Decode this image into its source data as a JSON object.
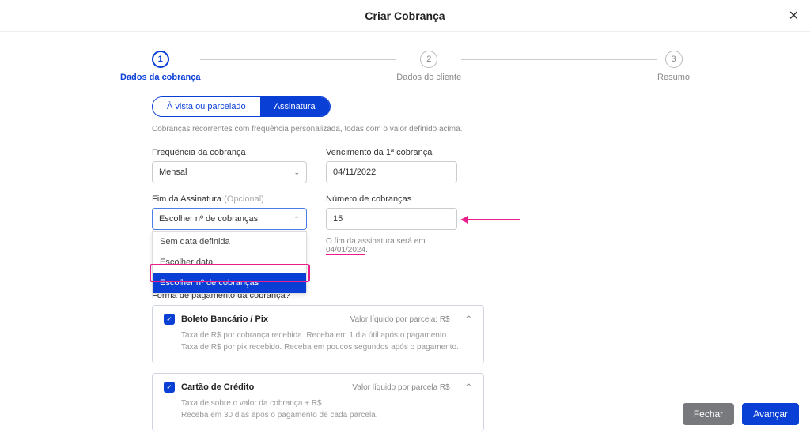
{
  "header": {
    "title": "Criar Cobrança"
  },
  "stepper": {
    "steps": [
      {
        "num": "1",
        "label": "Dados da cobrança"
      },
      {
        "num": "2",
        "label": "Dados do cliente"
      },
      {
        "num": "3",
        "label": "Resumo"
      }
    ]
  },
  "tabs": {
    "avista": "À vista ou parcelado",
    "assinatura": "Assinatura"
  },
  "helper": "Cobranças recorrentes com frequência personalizada, todas com o valor definido acima.",
  "freq": {
    "label": "Frequência da cobrança",
    "value": "Mensal"
  },
  "venc": {
    "label": "Vencimento da 1ª cobrança",
    "value": "04/11/2022"
  },
  "fim": {
    "label": "Fim da Assinatura ",
    "opt": "(Opcional)",
    "value": "Escolher nº de cobranças",
    "options": [
      "Sem data definida",
      "Escolher data",
      "Escolher nº de cobranças"
    ]
  },
  "num": {
    "label": "Número de cobranças",
    "value": "15",
    "hint_prefix": "O fim da assinatura será em ",
    "hint_date": "04/01/2024",
    "hint_suffix": "."
  },
  "forma": {
    "label": "Forma de pagamento da cobrança?"
  },
  "pm1": {
    "title": "Boleto Bancário / Pix",
    "right": "Valor líquido por parcela: R$",
    "line1": "Taxa de R$        por cobrança recebida. Receba em 1 dia útil após o pagamento.",
    "line2": "Taxa de R$        por pix recebido. Receba em poucos segundos após o pagamento."
  },
  "pm2": {
    "title": "Cartão de Crédito",
    "right": "Valor líquido por parcela R$",
    "line1": "Taxa de         sobre o valor da cobrança + R$",
    "line2": "Receba em 30 dias após o pagamento de cada parcela."
  },
  "footer": {
    "close": "Fechar",
    "next": "Avançar"
  }
}
